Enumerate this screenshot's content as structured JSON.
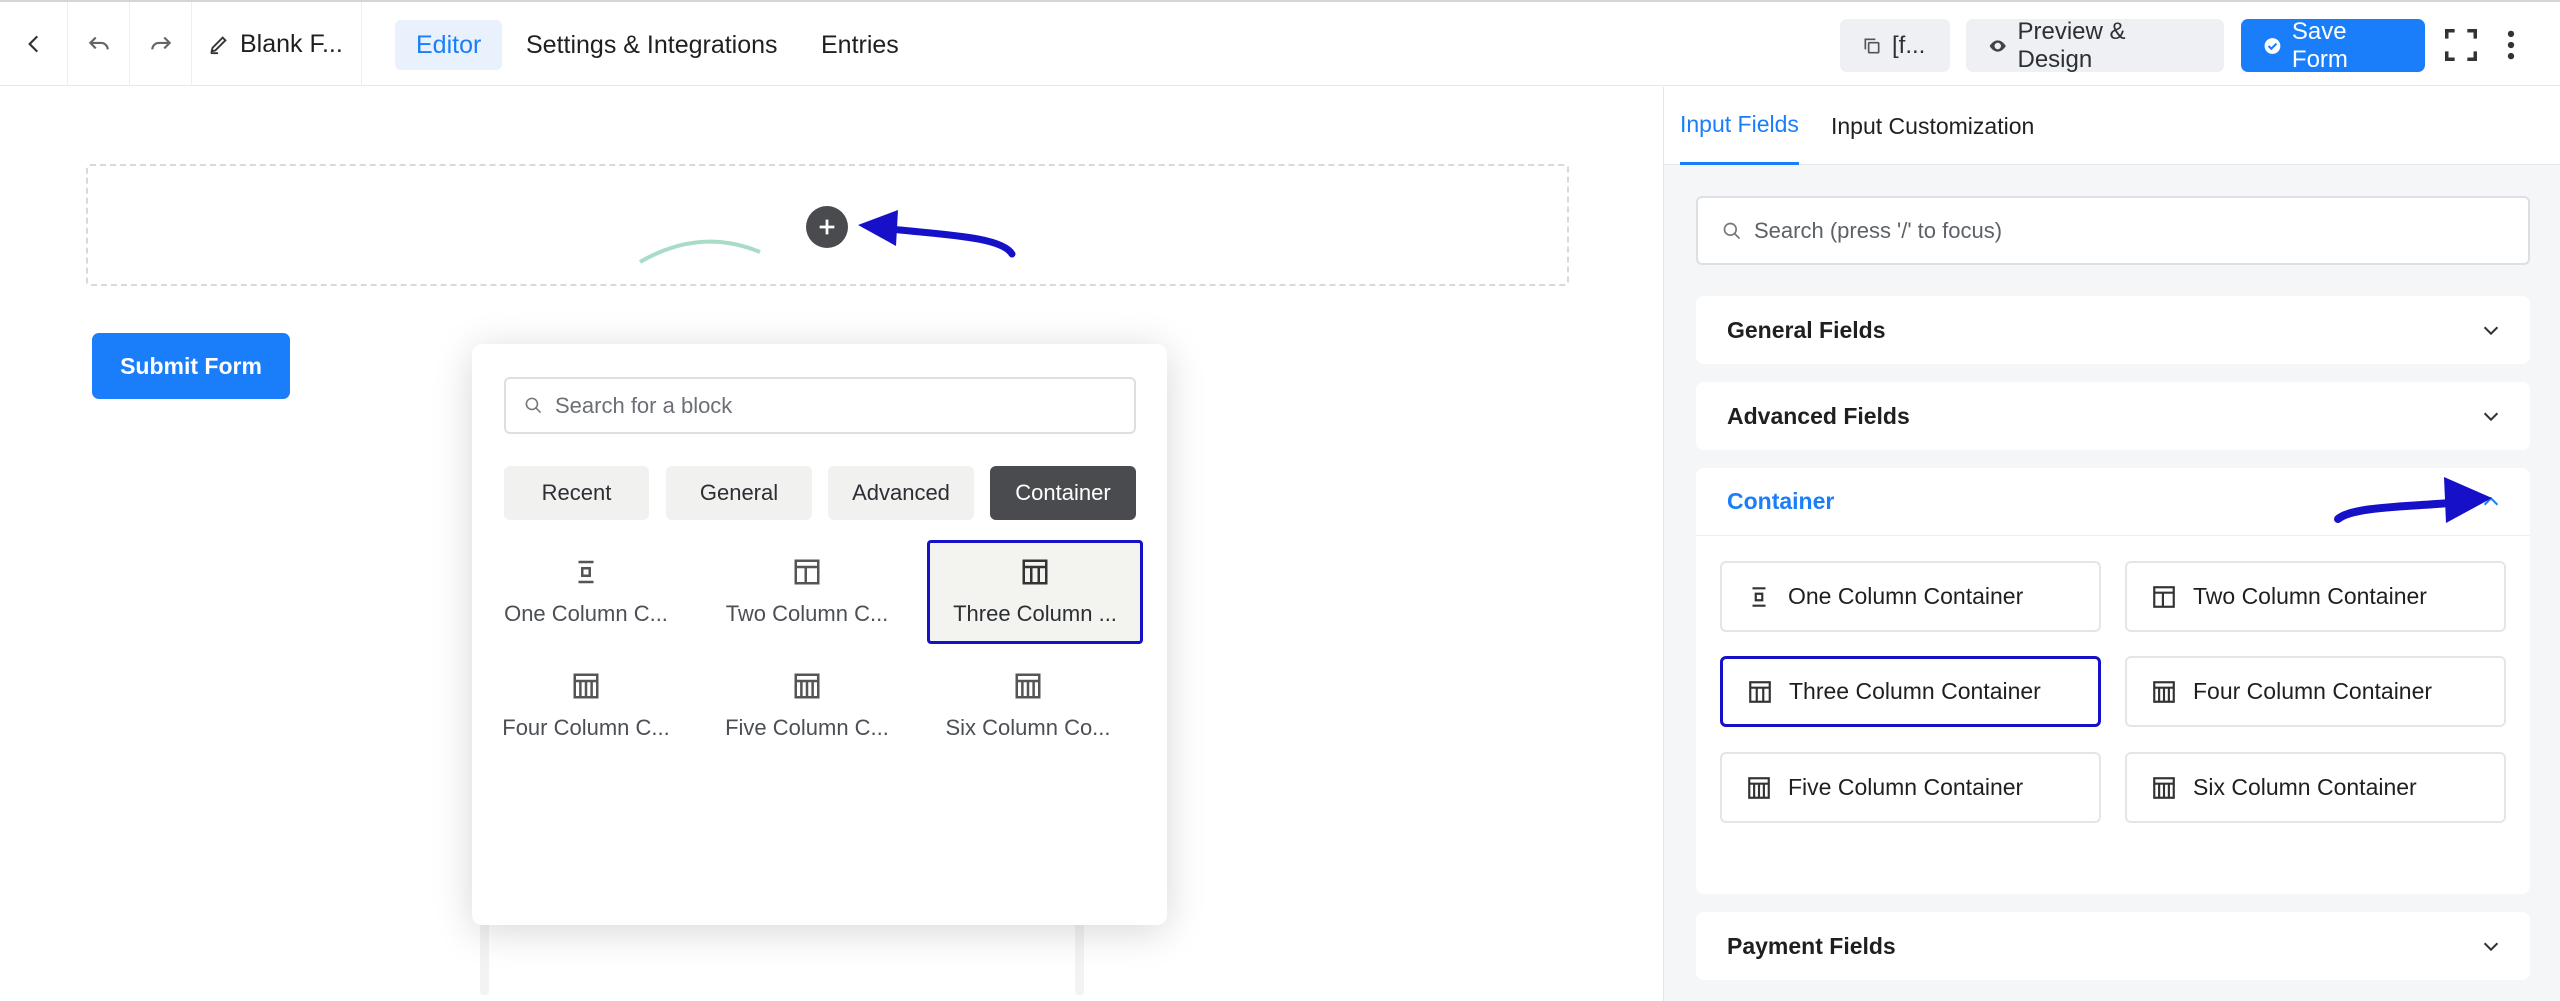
{
  "header": {
    "form_title": "Blank F...",
    "tabs": [
      "Editor",
      "Settings & Integrations",
      "Entries"
    ],
    "shortcode_label": "[f...",
    "preview_label": "Preview & Design",
    "save_label": "Save Form"
  },
  "canvas": {
    "submit_label": "Submit Form"
  },
  "block_picker": {
    "search_placeholder": "Search for a block",
    "categories": [
      "Recent",
      "General",
      "Advanced",
      "Container"
    ],
    "active_category": "Container",
    "blocks": [
      "One Column C...",
      "Two Column C...",
      "Three Column ...",
      "Four Column C...",
      "Five Column C...",
      "Six Column Co..."
    ],
    "selected_block": "Three Column ..."
  },
  "sidebar": {
    "tabs": [
      "Input Fields",
      "Input Customization"
    ],
    "search_placeholder": "Search (press '/' to focus)",
    "sections": [
      "General Fields",
      "Advanced Fields",
      "Container",
      "Payment Fields"
    ],
    "open_section": "Container",
    "container_items": [
      "One Column Container",
      "Two Column Container",
      "Three Column Container",
      "Four Column Container",
      "Five Column Container",
      "Six Column Container"
    ],
    "selected_item": "Three Column Container"
  },
  "colors": {
    "accent": "#1a7efb",
    "annotation": "#1611c9",
    "dark_button": "#4a4b4e"
  }
}
